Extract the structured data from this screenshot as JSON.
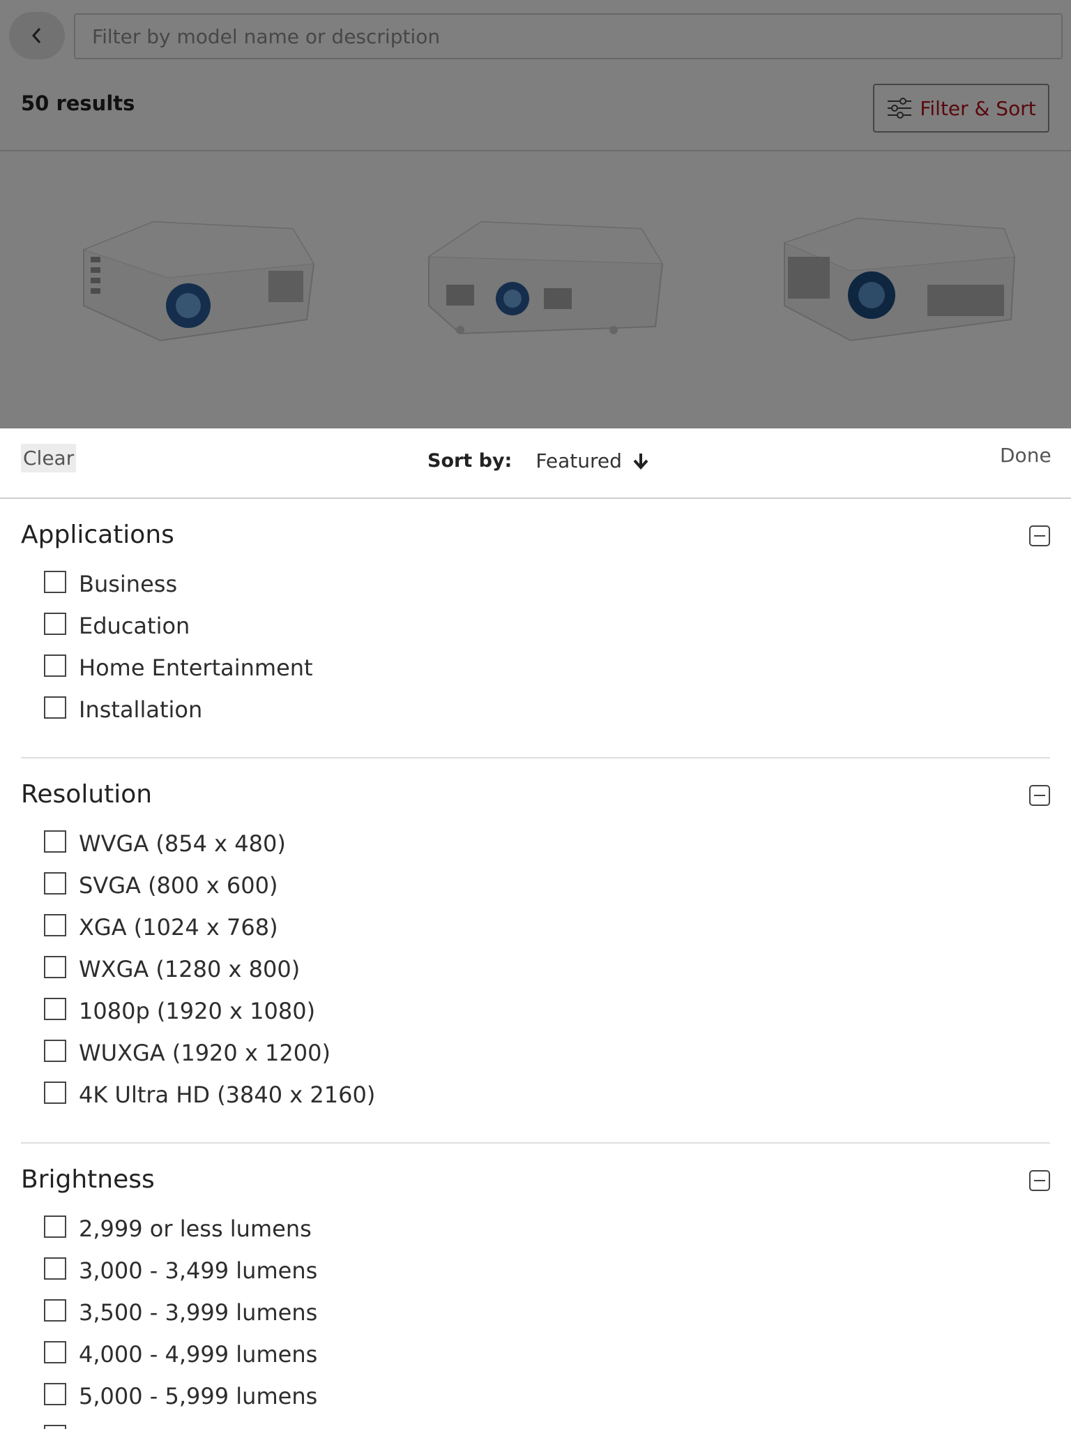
{
  "search": {
    "placeholder": "Filter by model name or description"
  },
  "results": {
    "count_label": "50 results",
    "filter_button_label": "Filter & Sort"
  },
  "products": [
    {
      "name": "projector-1"
    },
    {
      "name": "projector-2"
    },
    {
      "name": "projector-3"
    }
  ],
  "sheet": {
    "clear_label": "Clear",
    "sort_label": "Sort by:",
    "sort_value": "Featured",
    "done_label": "Done"
  },
  "filters": [
    {
      "title": "Applications",
      "options": [
        "Business",
        "Education",
        "Home Entertainment",
        "Installation"
      ]
    },
    {
      "title": "Resolution",
      "options": [
        "WVGA (854 x 480)",
        "SVGA (800 x 600)",
        "XGA (1024 x 768)",
        "WXGA (1280 x 800)",
        "1080p (1920 x 1080)",
        "WUXGA (1920 x 1200)",
        "4K Ultra HD (3840 x 2160)"
      ]
    },
    {
      "title": "Brightness",
      "options": [
        "2,999 or less lumens",
        "3,000 - 3,499 lumens",
        "3,500 - 3,999 lumens",
        "4,000 - 4,999 lumens",
        "5,000 - 5,999 lumens"
      ]
    }
  ],
  "colors": {
    "accent": "#b3111b",
    "overlay": "rgba(0,0,0,0.5)"
  }
}
